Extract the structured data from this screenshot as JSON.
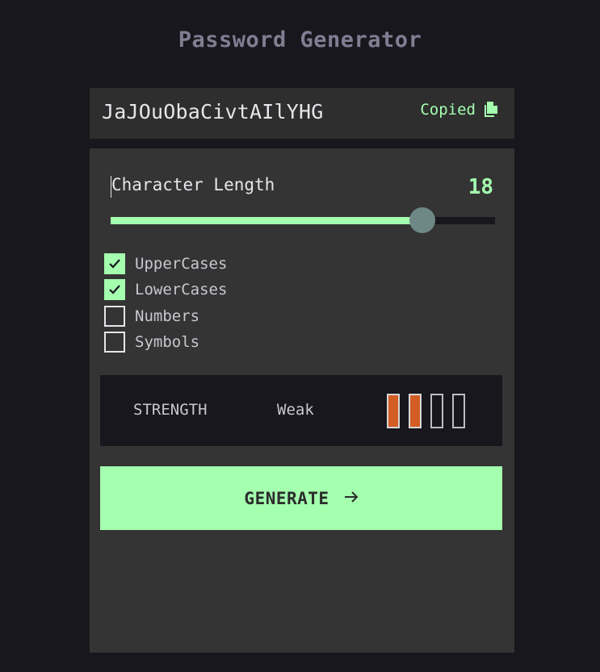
{
  "app": {
    "title": "Password Generator"
  },
  "password": {
    "value": "JaJOuObaCivtAIlYHG",
    "copied_label": "Copied",
    "copy_icon": "copy-icon"
  },
  "length": {
    "label": "Character Length",
    "value": "18",
    "fraction": 0.81
  },
  "options": [
    {
      "label": "UpperCases",
      "checked": true
    },
    {
      "label": "LowerCases",
      "checked": true
    },
    {
      "label": "Numbers",
      "checked": false
    },
    {
      "label": "Symbols",
      "checked": false
    }
  ],
  "strength": {
    "label": "STRENGTH",
    "level": "Weak",
    "bars_filled": 2,
    "bars_total": 4
  },
  "generate": {
    "label": "GENERATE",
    "icon": "arrow-right-icon"
  },
  "colors": {
    "accent": "#a4ffaf",
    "background": "#18171d",
    "panel": "#343434",
    "weak": "#d35d24",
    "thumb": "#6e8888"
  }
}
